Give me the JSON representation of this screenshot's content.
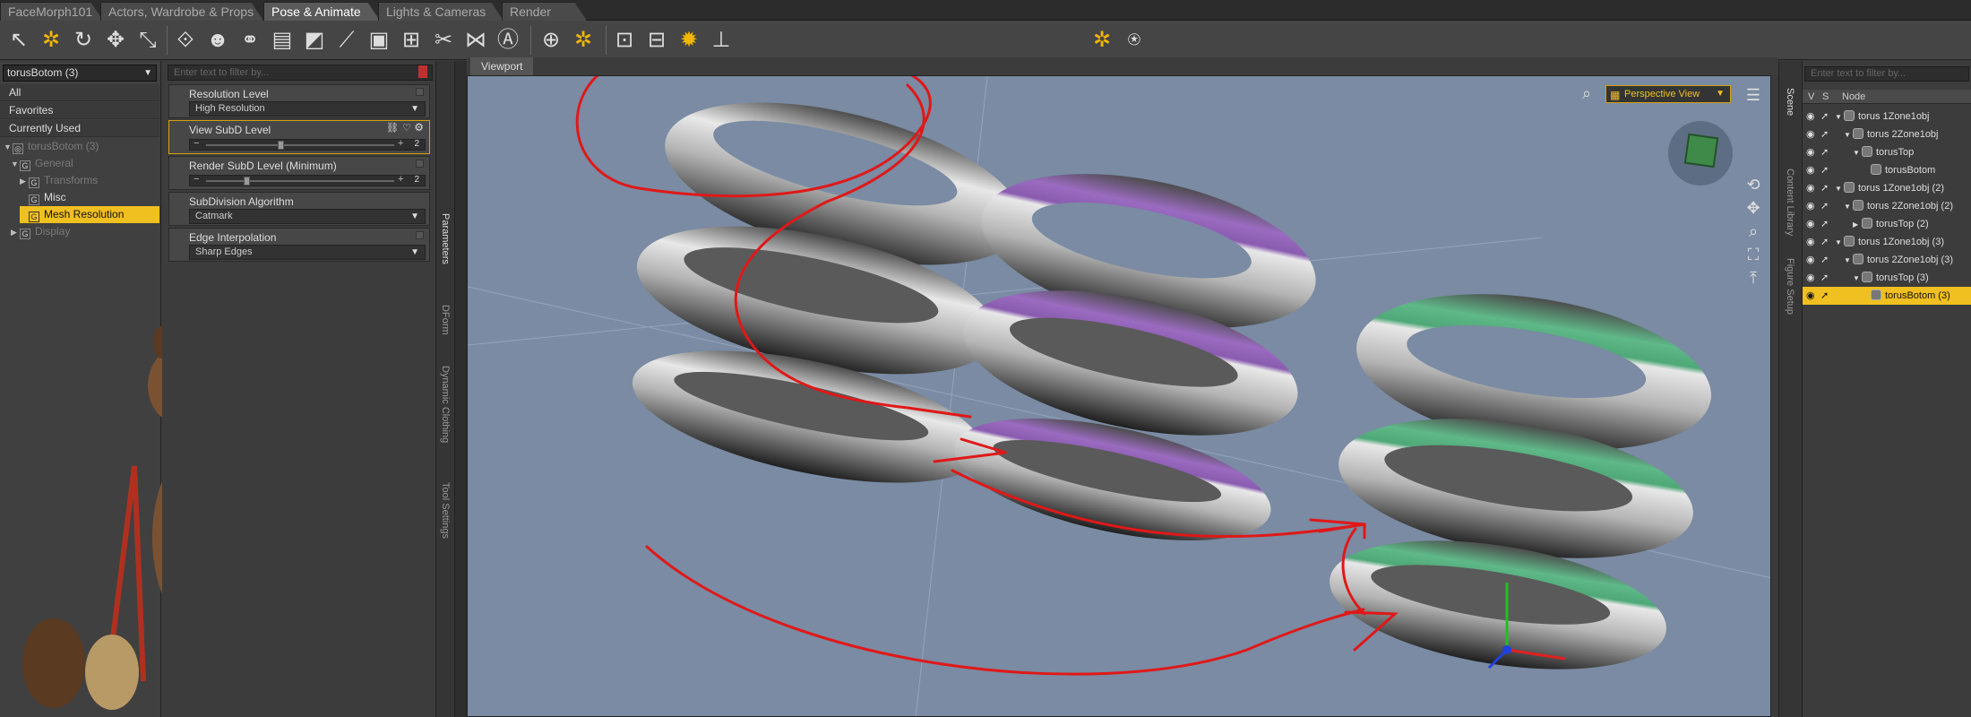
{
  "tabs": [
    {
      "label": "FaceMorph101",
      "active": false
    },
    {
      "label": "Actors, Wardrobe & Props",
      "active": false
    },
    {
      "label": "Pose & Animate",
      "active": true
    },
    {
      "label": "Lights & Cameras",
      "active": false
    },
    {
      "label": "Render",
      "active": false
    }
  ],
  "left_panel": {
    "selected_node": "torusBotom (3)",
    "filters": [
      "All",
      "Favorites",
      "Currently Used"
    ],
    "tree": [
      {
        "label": "torusBotom (3)",
        "dim": true
      },
      {
        "label": "General",
        "dim": true
      },
      {
        "label": "Transforms",
        "dim": true
      },
      {
        "label": "Misc",
        "dim": false
      },
      {
        "label": "Mesh Resolution",
        "highlighted": true
      },
      {
        "label": "Display",
        "dim": true
      }
    ]
  },
  "params": {
    "filter_placeholder": "Enter text to filter by...",
    "resolution_level": {
      "label": "Resolution Level",
      "value": "High Resolution"
    },
    "view_subd": {
      "label": "View SubD Level",
      "value": "2",
      "fraction": 0.38
    },
    "render_subd": {
      "label": "Render SubD Level (Minimum)",
      "value": "2",
      "fraction": 0.2
    },
    "subdivision_algorithm": {
      "label": "SubDivision Algorithm",
      "value": "Catmark"
    },
    "edge_interpolation": {
      "label": "Edge Interpolation",
      "value": "Sharp Edges"
    }
  },
  "params_side_tabs": [
    "Parameters",
    "DForm",
    "Dynamic Clothing",
    "Tool Settings"
  ],
  "viewport": {
    "tab_label": "Viewport",
    "view_mode": "Perspective View",
    "torus_colors": {
      "gray": "#b8b8b8",
      "purple": "#9a6bc0",
      "green": "#5fb888"
    }
  },
  "scene_side_tabs": [
    "Scene",
    "Content Library",
    "Figure Setup"
  ],
  "scene": {
    "filter_placeholder": "Enter text to filter by...",
    "columns": [
      "V",
      "S",
      "Node"
    ],
    "rows": [
      {
        "label": "torus 1Zone1obj",
        "depth": 0,
        "arrow": "▼",
        "highlighted": false
      },
      {
        "label": "torus 2Zone1obj",
        "depth": 1,
        "arrow": "▼",
        "highlighted": false
      },
      {
        "label": "torusTop",
        "depth": 2,
        "arrow": "▼",
        "highlighted": false
      },
      {
        "label": "torusBotom",
        "depth": 3,
        "arrow": "",
        "highlighted": false
      },
      {
        "label": "torus 1Zone1obj (2)",
        "depth": 0,
        "arrow": "▼",
        "highlighted": false
      },
      {
        "label": "torus 2Zone1obj (2)",
        "depth": 1,
        "arrow": "▼",
        "highlighted": false
      },
      {
        "label": "torusTop (2)",
        "depth": 2,
        "arrow": "▶",
        "highlighted": false
      },
      {
        "label": "torus 1Zone1obj (3)",
        "depth": 0,
        "arrow": "▼",
        "highlighted": false
      },
      {
        "label": "torus 2Zone1obj (3)",
        "depth": 1,
        "arrow": "▼",
        "highlighted": false
      },
      {
        "label": "torusTop (3)",
        "depth": 2,
        "arrow": "▼",
        "highlighted": false
      },
      {
        "label": "torusBotom (3)",
        "depth": 3,
        "arrow": "",
        "highlighted": true
      }
    ]
  }
}
